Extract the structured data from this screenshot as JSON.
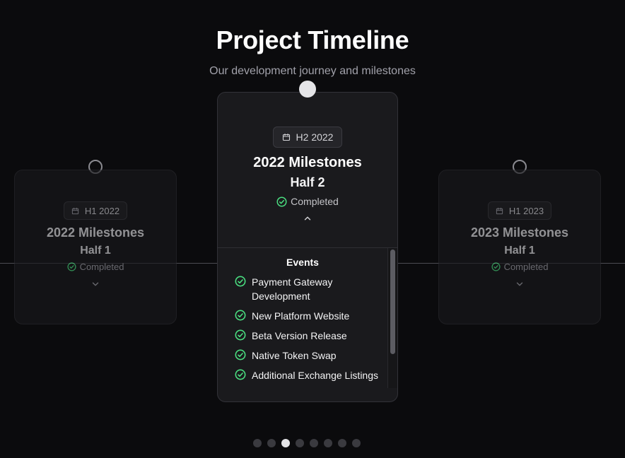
{
  "header": {
    "title": "Project Timeline",
    "subtitle": "Our development journey and milestones"
  },
  "cards": [
    {
      "period": "H1 2022",
      "title": "2022 Milestones",
      "subtitle": "Half 1",
      "status": "Completed",
      "expanded": false
    },
    {
      "period": "H2 2022",
      "title": "2022 Milestones",
      "subtitle": "Half 2",
      "status": "Completed",
      "expanded": true,
      "events_title": "Events",
      "events": [
        "Payment Gateway Development",
        "New Platform Website",
        "Beta Version Release",
        "Native Token Swap",
        "Additional Exchange Listings"
      ]
    },
    {
      "period": "H1 2023",
      "title": "2023 Milestones",
      "subtitle": "Half 1",
      "status": "Completed",
      "expanded": false
    }
  ],
  "pagination": {
    "total": 8,
    "active_index": 2
  },
  "colors": {
    "background": "#0b0b0d",
    "card": "#19191c",
    "success": "#4ade80",
    "text": "#f4f4f5",
    "muted": "#a1a1aa"
  },
  "icons": {
    "date": "calendar-icon",
    "status": "check-circle-icon",
    "collapsed": "chevron-down-icon",
    "expanded": "chevron-up-icon"
  }
}
